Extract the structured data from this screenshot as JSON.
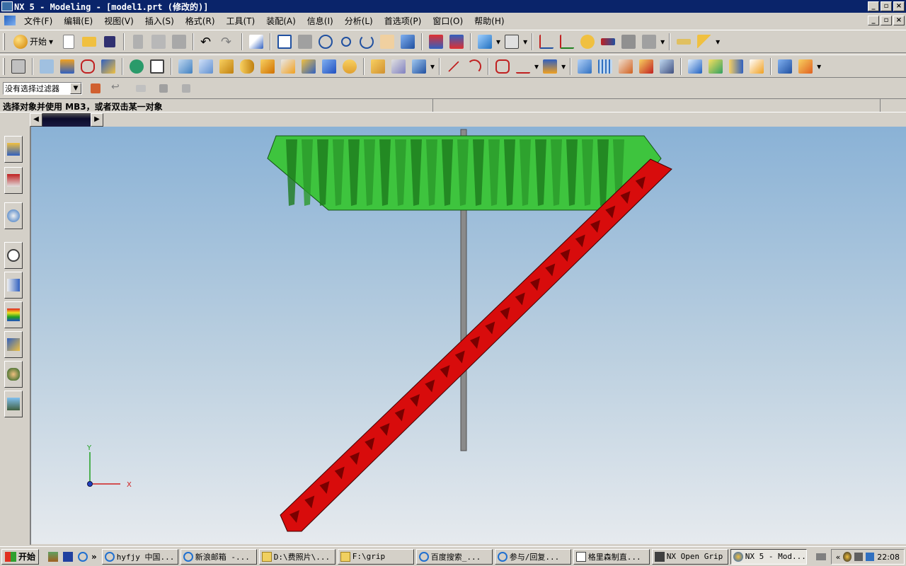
{
  "window": {
    "title": "NX 5 - Modeling - [model1.prt (修改的)]",
    "controls": [
      "_",
      "▫",
      "×"
    ],
    "mdi_controls": [
      "_",
      "▫",
      "×"
    ]
  },
  "menu": [
    "文件(F)",
    "编辑(E)",
    "视图(V)",
    "插入(S)",
    "格式(R)",
    "工具(T)",
    "装配(A)",
    "信息(I)",
    "分析(L)",
    "首选项(P)",
    "窗口(O)",
    "帮助(H)"
  ],
  "toolbar": {
    "start_label": "开始"
  },
  "selection": {
    "filter_value": "没有选择过滤器"
  },
  "status": {
    "message": "选择对象并使用 MB3，或者双击某一对象"
  },
  "viewport": {
    "axis_x": "X",
    "axis_y": "Y",
    "colors": {
      "gear": "#3ec43e",
      "rack": "#e01010",
      "shaft": "#8a8a8a"
    }
  },
  "taskbar": {
    "start_label": "开始",
    "more": "»",
    "tasks": [
      {
        "label": "hyfjy 中国...",
        "icon": "ie-icon"
      },
      {
        "label": "新浪邮箱 -...",
        "icon": "ie-icon"
      },
      {
        "label": "D:\\费照片\\...",
        "icon": "folder-icon"
      },
      {
        "label": "F:\\grip",
        "icon": "folder-icon"
      },
      {
        "label": "百度搜索_...",
        "icon": "ie-icon"
      },
      {
        "label": "参与/回复...",
        "icon": "ie-icon"
      },
      {
        "label": "格里森制直...",
        "icon": "doc-icon"
      },
      {
        "label": "NX Open Grip",
        "icon": "app-icon"
      },
      {
        "label": "NX 5 - Mod...",
        "icon": "nx-icon"
      }
    ],
    "tray_arrows": "«",
    "clock": "22:08"
  }
}
